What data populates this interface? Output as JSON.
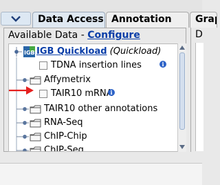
{
  "tabs": {
    "collapse_icon": "chevron-down-icon",
    "items": [
      {
        "label": "Data Access",
        "active": true
      },
      {
        "label": "Annotation",
        "active": false
      },
      {
        "label": "Grap",
        "active": false
      }
    ]
  },
  "panel": {
    "title_prefix": "Available Data - ",
    "configure_label": "Configure"
  },
  "tree": {
    "root": {
      "label": "IGB Quickload",
      "suffix": " (Quickload)",
      "logo_text": "IGB"
    },
    "items": [
      {
        "label": "TDNA insertion lines",
        "type": "checkbox",
        "info": true
      },
      {
        "label": "Affymetrix",
        "type": "folder"
      },
      {
        "label": "TAIR10 mRNA",
        "type": "checkbox",
        "info": true,
        "highlighted": true
      },
      {
        "label": "TAIR10 other annotations",
        "type": "folder"
      },
      {
        "label": "RNA-Seq",
        "type": "folder"
      },
      {
        "label": "ChIP-Chip",
        "type": "folder"
      },
      {
        "label": "ChIP-Seq",
        "type": "folder"
      }
    ]
  },
  "right_panel": {
    "letter": "D"
  },
  "colors": {
    "link": "#0a3ea8",
    "info": "#2c62c7",
    "arrow": "#e5201f"
  }
}
